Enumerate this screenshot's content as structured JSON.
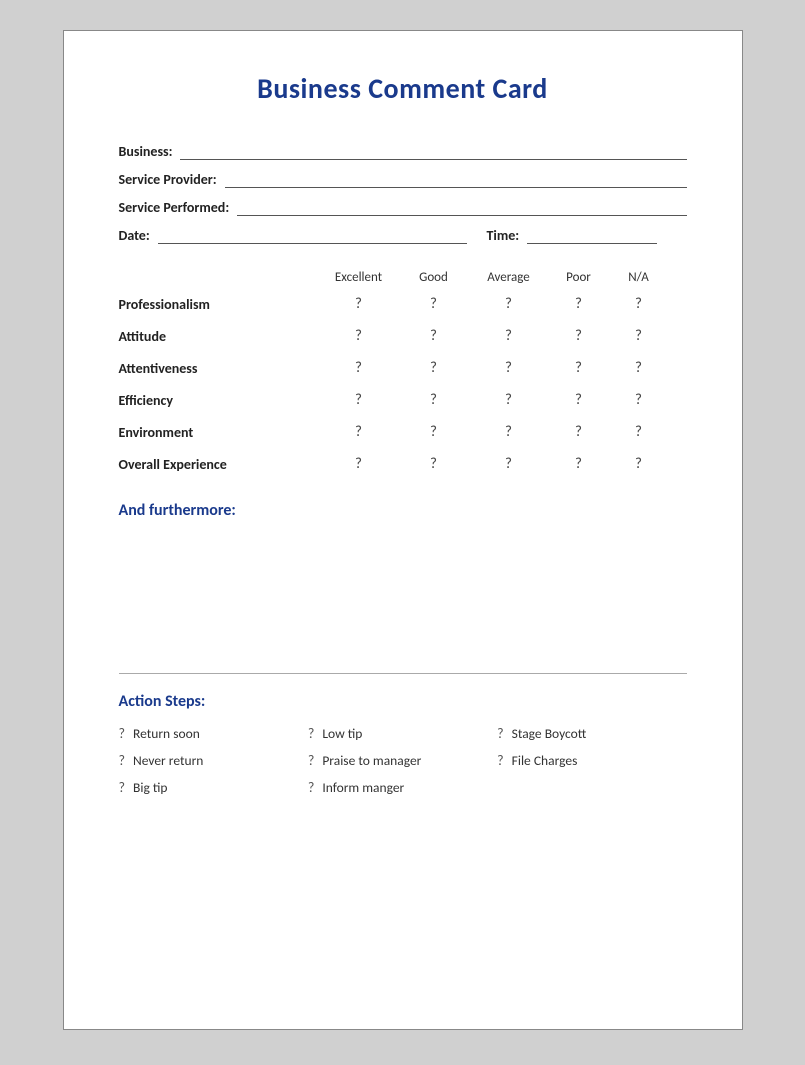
{
  "card": {
    "title": "Business Comment Card",
    "fields": {
      "business_label": "Business:",
      "service_provider_label": "Service Provider:",
      "service_performed_label": "Service Performed:",
      "date_label": "Date:",
      "time_label": "Time:"
    },
    "ratings": {
      "columns": [
        "",
        "Excellent",
        "Good",
        "Average",
        "Poor",
        "N/A"
      ],
      "rows": [
        {
          "label": "Professionalism",
          "symbol": "?"
        },
        {
          "label": "Attitude",
          "symbol": "?"
        },
        {
          "label": "Attentiveness",
          "symbol": "?"
        },
        {
          "label": "Efficiency",
          "symbol": "?"
        },
        {
          "label": "Environment",
          "symbol": "?"
        },
        {
          "label": "Overall Experience",
          "symbol": "?"
        }
      ]
    },
    "furthermore": {
      "title": "And furthermore:"
    },
    "action_steps": {
      "title": "Action Steps:",
      "items": [
        {
          "symbol": "?",
          "label": "Return soon"
        },
        {
          "symbol": "?",
          "label": "Low tip"
        },
        {
          "symbol": "?",
          "label": "Stage Boycott"
        },
        {
          "symbol": "?",
          "label": "Never return"
        },
        {
          "symbol": "?",
          "label": "Praise to manager"
        },
        {
          "symbol": "?",
          "label": "File Charges"
        },
        {
          "symbol": "?",
          "label": "Big tip"
        },
        {
          "symbol": "?",
          "label": "Inform manger"
        }
      ]
    }
  }
}
